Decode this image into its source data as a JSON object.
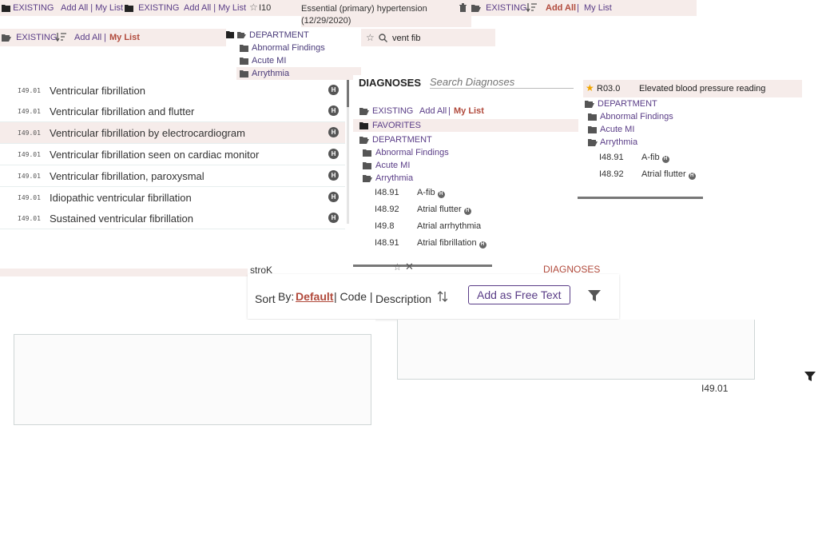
{
  "top_strip": {
    "existing_1": "EXISTING",
    "addall_1": "Add All | My List",
    "existing_2": "EXISTING",
    "addall_2": "Add All | My List",
    "dx_code": "I10",
    "dx_desc": "Essential (primary) hypertension",
    "dx_date": "(12/29/2020)",
    "existing_3": "EXISTING",
    "addall_3": "Add All",
    "mylist_3": "My List"
  },
  "second_strip": {
    "existing": "EXISTING",
    "addall": "Add All",
    "mylist": "My List",
    "search_value": "vent fib"
  },
  "tree_top": {
    "department": "DEPARTMENT",
    "items": [
      "Abnormal Findings",
      "Acute MI",
      "Arrythmia"
    ]
  },
  "results": [
    {
      "code": "I49.01",
      "text": "Ventricular fibrillation",
      "badge": "H"
    },
    {
      "code": "I49.01",
      "text": "Ventricular fibrillation and flutter",
      "badge": "H"
    },
    {
      "code": "I49.01",
      "text": "Ventricular fibrillation by electrocardiogram",
      "badge": "H"
    },
    {
      "code": "I49.01",
      "text": "Ventricular fibrillation seen on cardiac monitor",
      "badge": "H"
    },
    {
      "code": "I49.01",
      "text": "Ventricular fibrillation, paroxysmal",
      "badge": "H"
    },
    {
      "code": "I49.01",
      "text": "Idiopathic ventricular fibrillation",
      "badge": "H"
    },
    {
      "code": "I49.01",
      "text": "Sustained ventricular fibrillation",
      "badge": "H"
    }
  ],
  "middle_panel": {
    "title": "DIAGNOSES",
    "search_placeholder": "Search Diagnoses",
    "existing": "EXISTING",
    "addall": "Add All",
    "mylist": "My List",
    "favorites": "FAVORITES",
    "department": "DEPARTMENT",
    "folders": [
      "Abnormal Findings",
      "Acute MI",
      "Arrythmia"
    ],
    "entries": [
      {
        "code": "I48.91",
        "desc": "A-fib",
        "badge": "H"
      },
      {
        "code": "I48.92",
        "desc": "Atrial flutter",
        "badge": "H"
      },
      {
        "code": "I49.8",
        "desc": "Atrial arrhythmia",
        "badge": ""
      },
      {
        "code": "I48.91",
        "desc": "Atrial fibrillation",
        "badge": "H"
      }
    ]
  },
  "right_panel": {
    "code": "R03.0",
    "desc": "Elevated blood pressure reading",
    "department": "DEPARTMENT",
    "folders": [
      "Abnormal Findings",
      "Acute MI",
      "Arrythmia"
    ],
    "entries": [
      {
        "code": "I48.91",
        "desc": "A-fib",
        "badge": "H"
      },
      {
        "code": "I48.92",
        "desc": "Atrial flutter",
        "badge": "H"
      }
    ]
  },
  "sort_bar": {
    "sort_label": "Sort",
    "by_label": "By:",
    "default": "Default",
    "code": "| Code |",
    "description": "Description",
    "add_free_text": "Add as Free Text",
    "stray_title": "DIAGNOSES",
    "stray_strop": "stroK",
    "stray_code": "I49.01"
  },
  "colors": {
    "accent": "#5a3d87",
    "highlight": "#f6ecea",
    "brand_red": "#b14a3c"
  }
}
